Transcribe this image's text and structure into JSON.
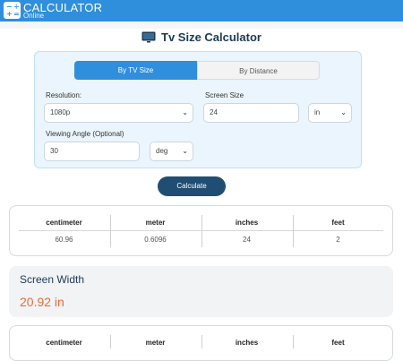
{
  "header": {
    "brand": "CALCULATOR",
    "brand_sub": "Online",
    "logo_glyphs": [
      "−",
      "÷",
      "+",
      "="
    ]
  },
  "page": {
    "title": "Tv Size Calculator",
    "icon": "tv-icon"
  },
  "tabs": [
    {
      "label": "By TV Size",
      "active": true
    },
    {
      "label": "By Distance",
      "active": false
    }
  ],
  "form": {
    "resolution_label": "Resolution:",
    "resolution_value": "1080p",
    "screen_size_label": "Screen Size",
    "screen_size_value": "24",
    "unit_value": "in",
    "viewing_angle_label": "Viewing Angle (Optional)",
    "viewing_angle_value": "30",
    "angle_unit_value": "deg"
  },
  "calculate_label": "Calculate",
  "size_table": {
    "headers": [
      "centimeter",
      "meter",
      "inches",
      "feet"
    ],
    "values": [
      "60.96",
      "0.6096",
      "24",
      "2"
    ]
  },
  "screen_width": {
    "title": "Screen Width",
    "value": "20.92 in"
  },
  "width_table": {
    "headers": [
      "centimeter",
      "meter",
      "inches",
      "feet"
    ]
  },
  "colors": {
    "accent": "#2f8fdc",
    "button": "#1f4e72",
    "result": "#ee6b3b"
  }
}
